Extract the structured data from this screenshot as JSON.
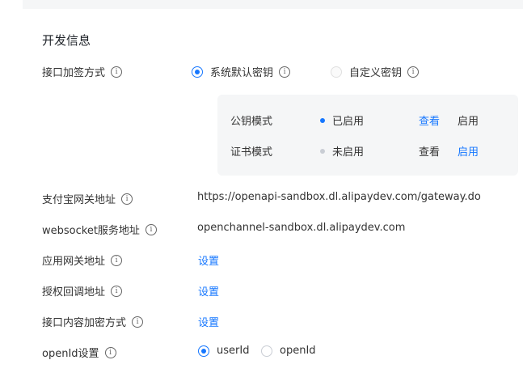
{
  "section": {
    "title": "开发信息"
  },
  "sign_method": {
    "label": "接口加签方式",
    "options": [
      {
        "label": "系统默认密钥",
        "checked": true
      },
      {
        "label": "自定义密钥",
        "checked": false
      }
    ]
  },
  "key_modes": [
    {
      "name": "公钥模式",
      "status": "已启用",
      "status_color": "#1677ff",
      "view": "查看",
      "view_is_link": true,
      "enable": "启用",
      "enable_is_link": false
    },
    {
      "name": "证书模式",
      "status": "未启用",
      "status_color": "#c9cdd4",
      "view": "查看",
      "view_is_link": false,
      "enable": "启用",
      "enable_is_link": true
    }
  ],
  "gateway": {
    "label": "支付宝网关地址",
    "value": "https://openapi-sandbox.dl.alipaydev.com/gateway.do"
  },
  "websocket": {
    "label": "websocket服务地址",
    "value": "openchannel-sandbox.dl.alipaydev.com"
  },
  "app_gateway": {
    "label": "应用网关地址",
    "action": "设置"
  },
  "auth_callback": {
    "label": "授权回调地址",
    "action": "设置"
  },
  "encrypt_method": {
    "label": "接口内容加密方式",
    "action": "设置"
  },
  "openid_setting": {
    "label": "openId设置",
    "options": [
      {
        "label": "userId",
        "checked": true
      },
      {
        "label": "openId",
        "checked": false
      }
    ]
  },
  "icons": {
    "info": "info-circle-icon",
    "info_glyph": "i"
  },
  "colors": {
    "accent": "#1677ff",
    "panel_bg": "#f5f6f7"
  }
}
